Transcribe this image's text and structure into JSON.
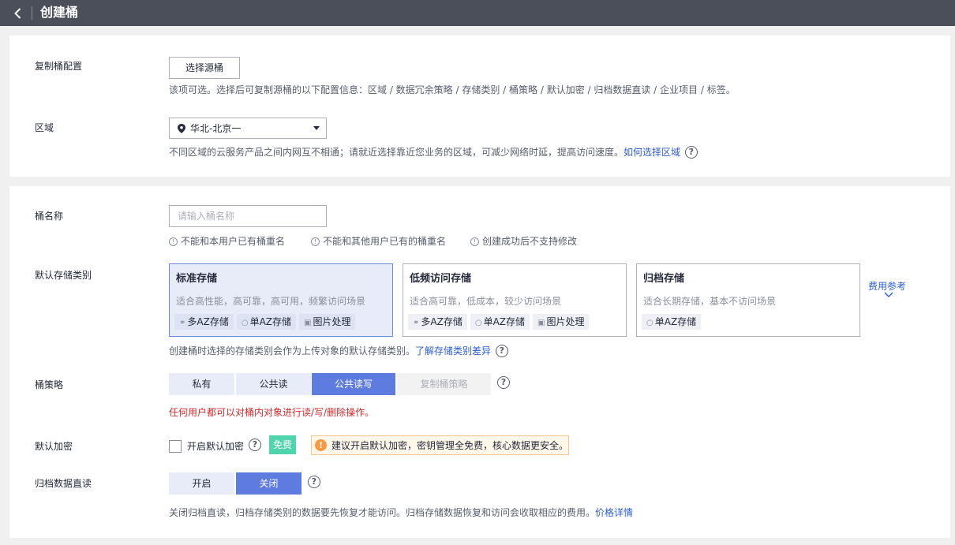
{
  "header": {
    "title": "创建桶",
    "back_icon": "chevron-left-icon"
  },
  "replication": {
    "label": "复制桶配置",
    "button": "选择源桶",
    "hint": "该项可选。选择后可复制源桶的以下配置信息：区域 / 数据冗余策略 / 存储类别 / 桶策略 / 默认加密 / 归档数据直读 / 企业项目 / 标签。"
  },
  "region": {
    "label": "区域",
    "value": "华北-北京一",
    "hint": "不同区域的云服务产品之间内网互不相通；请就近选择靠近您业务的区域，可减少网络时延，提高访问速度。",
    "link": "如何选择区域"
  },
  "bucket_name": {
    "label": "桶名称",
    "placeholder": "请输入桶名称",
    "value": "",
    "rules": [
      "不能和本用户已有桶重名",
      "不能和其他用户已有的桶重名",
      "创建成功后不支持修改"
    ]
  },
  "storage_class": {
    "label": "默认存储类别",
    "options": [
      {
        "title": "标准存储",
        "desc": "适合高性能，高可靠，高可用，频繁访问场景",
        "tags": [
          "多AZ存储",
          "单AZ存储",
          "图片处理"
        ],
        "selected": true
      },
      {
        "title": "低频访问存储",
        "desc": "适合高可靠，低成本，较少访问场景",
        "tags": [
          "多AZ存储",
          "单AZ存储",
          "图片处理"
        ],
        "selected": false
      },
      {
        "title": "归档存储",
        "desc": "适合长期存储，基本不访问场景",
        "tags": [
          "单AZ存储"
        ],
        "selected": false
      }
    ],
    "fee_ref": "费用参考",
    "hint": "创建桶时选择的存储类别会作为上传对象的默认存储类别。",
    "link": "了解存储类别差异"
  },
  "policy": {
    "label": "桶策略",
    "options": [
      "私有",
      "公共读",
      "公共读写",
      "复制桶策略"
    ],
    "selected": "公共读写",
    "warning": "任何用户都可以对桶内对象进行读/写/删除操作。"
  },
  "encryption": {
    "label": "默认加密",
    "checkbox_label": "开启默认加密",
    "checked": false,
    "badge": "免费",
    "tip": "建议开启默认加密，密钥管理全免费，核心数据更安全。"
  },
  "archive_read": {
    "label": "归档数据直读",
    "options": [
      "开启",
      "关闭"
    ],
    "selected": "关闭",
    "hint": "关闭归档直读，归档存储类别的数据要先恢复才能访问。归档存储数据恢复和访问会收取相应的费用。",
    "link": "价格详情"
  },
  "colors": {
    "topbar": "#4a4f5a",
    "accent": "#5e7ce0",
    "link": "#2b5ed6",
    "warning": "#d12a2a",
    "free_badge": "#50d4ab",
    "tip_icon": "#fa9841"
  }
}
